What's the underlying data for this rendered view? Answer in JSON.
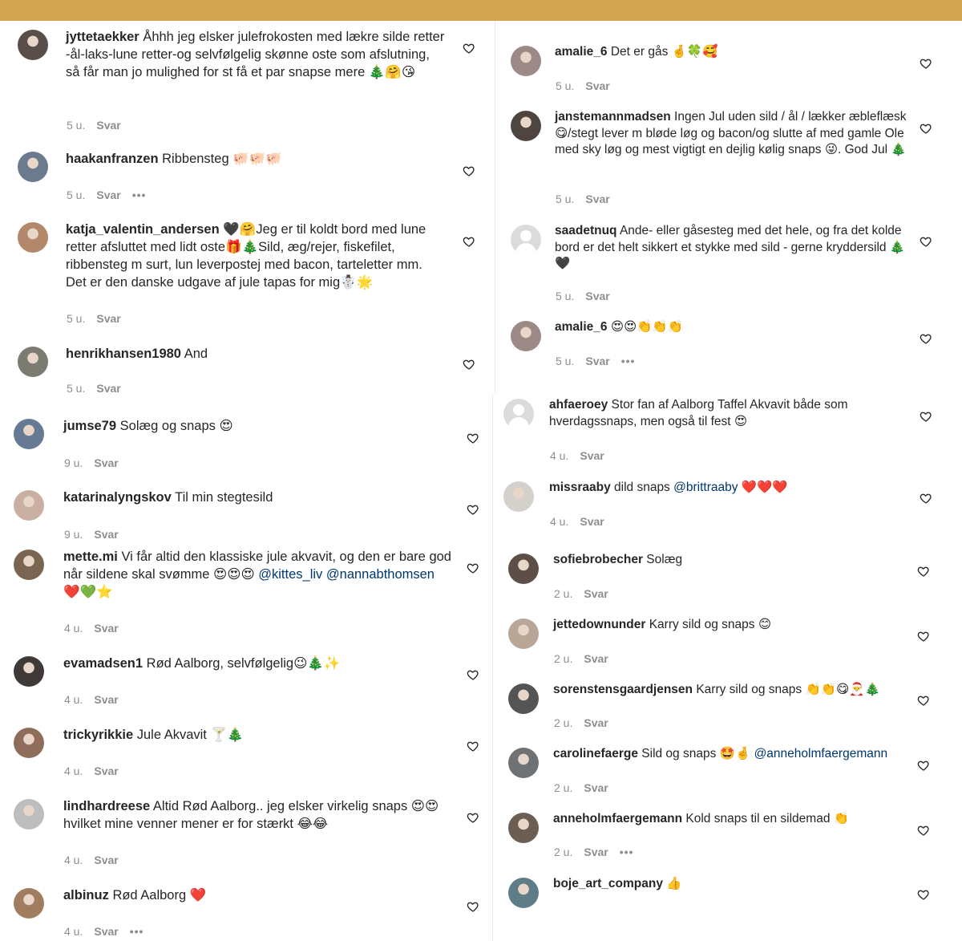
{
  "page": {
    "background": "#ffffff",
    "header_color": "#d2a650"
  },
  "left_column": [
    {
      "username": "jyttetaekker",
      "text": "Åhhh jeg elsker julefrokosten med lækre silde retter -ål-laks-lune retter-og selvfølgelig skønne oste som afslutning, så får man jo mulighed for st få et par snapse mere 🎄🤗😘",
      "time": "5 u.",
      "reply": "Svar",
      "avatar": "avatar-photo",
      "avatar_color": "#5a4e4a",
      "liked": false
    },
    {
      "username": "haakanfranzen",
      "text": "Ribbensteg 🐖🐖🐖",
      "time": "5 u.",
      "reply": "Svar",
      "more": "•••",
      "avatar": "avatar-photo",
      "avatar_color": "#6b7a8c"
    },
    {
      "username": "katja_valentin_andersen",
      "text": "🖤🤗Jeg er til koldt bord med lune retter afsluttet med lidt oste🎁🎄Sild, æg/rejer, fiskefilet, ribbensteg m surt, lun leverpostej med bacon, tarteletter mm. Det er den danske udgave af jule tapas for mig☃️🌟",
      "time": "5 u.",
      "reply": "Svar",
      "avatar": "avatar-photo",
      "avatar_color": "#b3876a"
    },
    {
      "username": "henrikhansen1980",
      "text": "And",
      "time": "5 u.",
      "reply": "Svar",
      "avatar": "avatar-photo",
      "avatar_color": "#7b7b72"
    },
    {
      "username": "jumse79",
      "text": "Solæg og snaps 😍",
      "time": "9 u.",
      "reply": "Svar",
      "avatar": "avatar-photo",
      "avatar_color": "#667a94"
    },
    {
      "username": "katarinalyngskov",
      "text": "Til min stegtesild",
      "time": "9 u.",
      "reply": "Svar",
      "avatar": "avatar-photo",
      "avatar_color": "#c9b0a3"
    },
    {
      "username": "mette.mi",
      "text": "Vi får altid den klassiske jule akvavit, og den er bare god når sildene skal svømme 😍😍😍",
      "mentions": [
        "@kittes_liv",
        "@nannabthomsen"
      ],
      "mention_tail": "❤️💚⭐",
      "time": "4 u.",
      "reply": "Svar",
      "avatar": "avatar-photo",
      "avatar_color": "#7a6553"
    },
    {
      "username": "evamadsen1",
      "text": "Rød Aalborg, selvfølgelig😉🎄✨",
      "time": "4 u.",
      "reply": "Svar",
      "avatar": "avatar-photo",
      "avatar_color": "#3f3a38"
    },
    {
      "username": "trickyrikkie",
      "text": "Jule Akvavit 🍸🎄",
      "time": "4 u.",
      "reply": "Svar",
      "avatar": "avatar-photo",
      "avatar_color": "#8f6d5b"
    },
    {
      "username": "lindhardreese",
      "text": "Altid Rød Aalborg.. jeg elsker virkelig snaps 😍😍 hvilket mine venner mener er for stærkt 😂😂",
      "time": "4 u.",
      "reply": "Svar",
      "avatar": "avatar-photo",
      "avatar_color": "#bdbdbd"
    },
    {
      "username": "albinuz",
      "text": "Rød Aalborg ❤️",
      "time": "4 u.",
      "reply": "Svar",
      "more": "•••",
      "avatar": "avatar-photo",
      "avatar_color": "#a07d5f"
    }
  ],
  "right_column": [
    {
      "username": "amalie_6",
      "text": "Det er gås 🤞🍀🥰",
      "time": "5 u.",
      "reply": "Svar",
      "avatar": "avatar-photo",
      "avatar_color": "#9d8a86"
    },
    {
      "username": "janstemannmadsen",
      "text": "Ingen Jul uden sild / ål / lækker æbleflæsk 😋/stegt lever m bløde løg og bacon/og slutte af med gamle Ole med sky løg og mest vigtigt en dejlig kølig snaps 😜. God Jul 🎄",
      "time": "5 u.",
      "reply": "Svar",
      "avatar": "avatar-photo",
      "avatar_color": "#4f4540"
    },
    {
      "username": "saadetnuq",
      "text": "Ande- eller gåsesteg med det hele, og fra det kolde bord er det helt sikkert et stykke med sild - gerne kryddersild 🎄🖤",
      "time": "5 u.",
      "reply": "Svar",
      "avatar": "default-avatar"
    },
    {
      "username": "amalie_6",
      "text": "😍😍👏👏👏",
      "time": "5 u.",
      "reply": "Svar",
      "more": "•••",
      "avatar": "avatar-photo",
      "avatar_color": "#9d8a86"
    },
    {
      "username": "ahfaeroey",
      "text": "Stor fan af Aalborg Taffel Akvavit både som hverdagssnaps, men også til fest 😍",
      "time": "4 u.",
      "reply": "Svar",
      "avatar": "default-avatar"
    },
    {
      "username": "missraaby",
      "text": "dild snaps",
      "mentions": [
        "@brittraaby"
      ],
      "mention_tail": "❤️❤️❤️",
      "time": "4 u.",
      "reply": "Svar",
      "avatar": "avatar-photo",
      "avatar_color": "#d4d0cc"
    },
    {
      "username": "sofiebrobecher",
      "text": "Solæg",
      "time": "2 u.",
      "reply": "Svar",
      "avatar": "avatar-photo",
      "avatar_color": "#5d4f48"
    },
    {
      "username": "jettedownunder",
      "text": "Karry sild og snaps 😊",
      "time": "2 u.",
      "reply": "Svar",
      "avatar": "avatar-photo",
      "avatar_color": "#b8a796"
    },
    {
      "username": "sorenstensgaardjensen",
      "text": "Karry sild og snaps 👏👏😋🎅🎄",
      "time": "2 u.",
      "reply": "Svar",
      "avatar": "avatar-photo",
      "avatar_color": "#545454"
    },
    {
      "username": "carolinefaerge",
      "text": "Sild og snaps 🤩🤞",
      "mentions": [
        "@anneholmfaergemann"
      ],
      "mention_tail": "",
      "time": "2 u.",
      "reply": "Svar",
      "avatar": "avatar-photo",
      "avatar_color": "#6f7275"
    },
    {
      "username": "anneholmfaergemann",
      "text": "Kold snaps til en sildemad 👏",
      "time": "2 u.",
      "reply": "Svar",
      "more": "•••",
      "avatar": "avatar-photo",
      "avatar_color": "#6d5e53"
    },
    {
      "username": "boje_art_company",
      "text": "👍",
      "time": "",
      "reply": "",
      "avatar": "avatar-photo",
      "avatar_color": "#5f7d86"
    }
  ]
}
